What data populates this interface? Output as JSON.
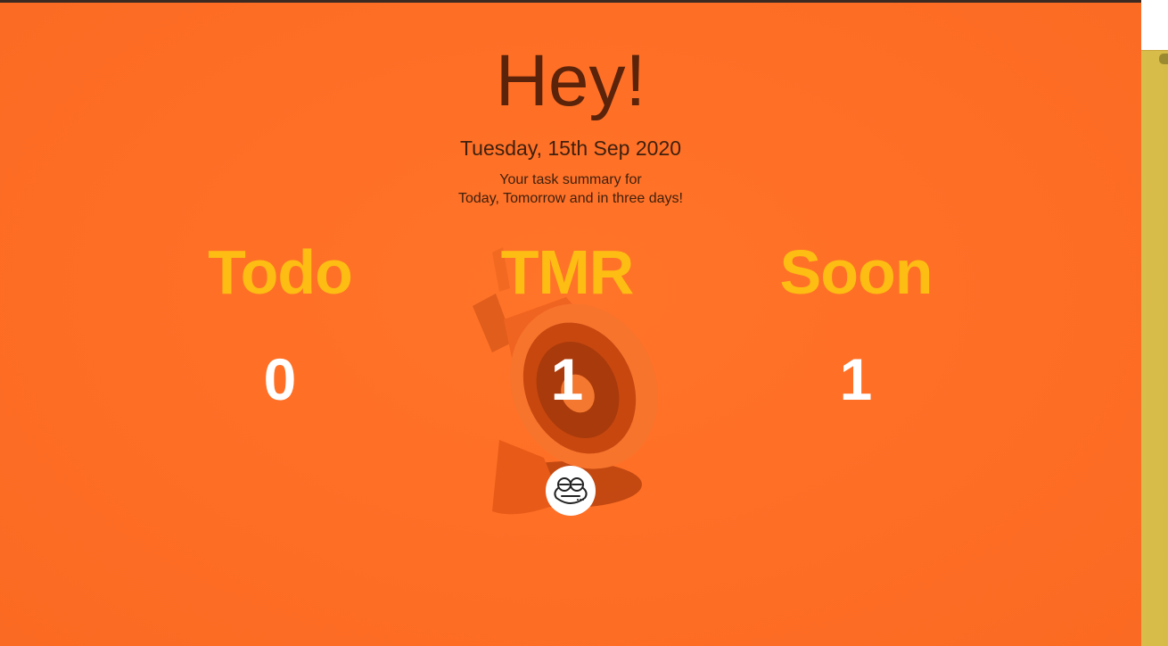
{
  "header": {
    "greeting": "Hey!",
    "date": "Tuesday, 15th Sep 2020",
    "summary_line1": "Your task summary for",
    "summary_line2": "Today, Tomorrow and in three days!"
  },
  "columns": [
    {
      "label": "Todo",
      "count": "0"
    },
    {
      "label": "TMR",
      "count": "1"
    },
    {
      "label": "Soon",
      "count": "1"
    }
  ],
  "icons": {
    "background_art": "megaphone-icon",
    "action_button": "frog-face-icon"
  },
  "colors": {
    "background": "#ff6e25",
    "greeting_text": "#5a230a",
    "label_text": "#fdbd13",
    "count_text": "#ffffff",
    "side_strip": "#d6bb48"
  }
}
